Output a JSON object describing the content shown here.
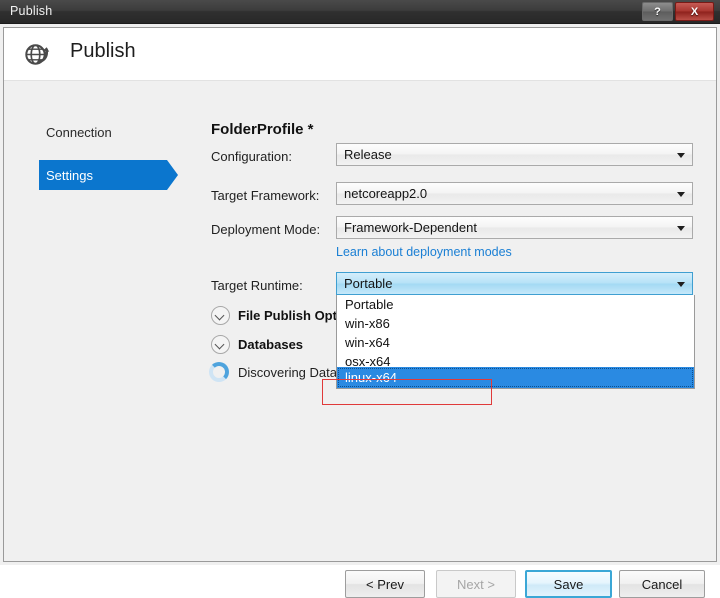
{
  "titlebar": {
    "title": "Publish",
    "help_label": "?",
    "close_label": "X"
  },
  "header": {
    "title": "Publish",
    "icon": "globe-publish-icon"
  },
  "sidebar": {
    "items": [
      {
        "label": "Connection",
        "selected": false
      },
      {
        "label": "Settings",
        "selected": true
      }
    ]
  },
  "main": {
    "profile_title": "FolderProfile *",
    "fields": [
      {
        "label": "Configuration:",
        "value": "Release"
      },
      {
        "label": "Target Framework:",
        "value": "netcoreapp2.0"
      },
      {
        "label": "Deployment Mode:",
        "value": "Framework-Dependent"
      },
      {
        "label": "Target Runtime:",
        "value": "Portable"
      }
    ],
    "deployment_link": "Learn about deployment modes",
    "sections": [
      {
        "label": "File Publish Options"
      },
      {
        "label": "Databases"
      }
    ],
    "status": {
      "text": "Discovering Databases...",
      "icon": "loading-spinner-icon"
    },
    "target_runtime_dropdown": {
      "open": true,
      "options": [
        "Portable",
        "win-x86",
        "win-x64",
        "osx-x64",
        "linux-x64"
      ],
      "selected": "linux-x64"
    }
  },
  "footer": {
    "buttons": [
      {
        "label": "< Prev",
        "state": "enabled"
      },
      {
        "label": "Next >",
        "state": "disabled"
      },
      {
        "label": "Save",
        "state": "primary"
      },
      {
        "label": "Cancel",
        "state": "enabled"
      }
    ]
  },
  "colors": {
    "accent": "#0b76ce",
    "link": "#1a7fd4",
    "selection": "#2a8ae2",
    "annotation": "#e03a3a",
    "close_button": "#a93630"
  }
}
